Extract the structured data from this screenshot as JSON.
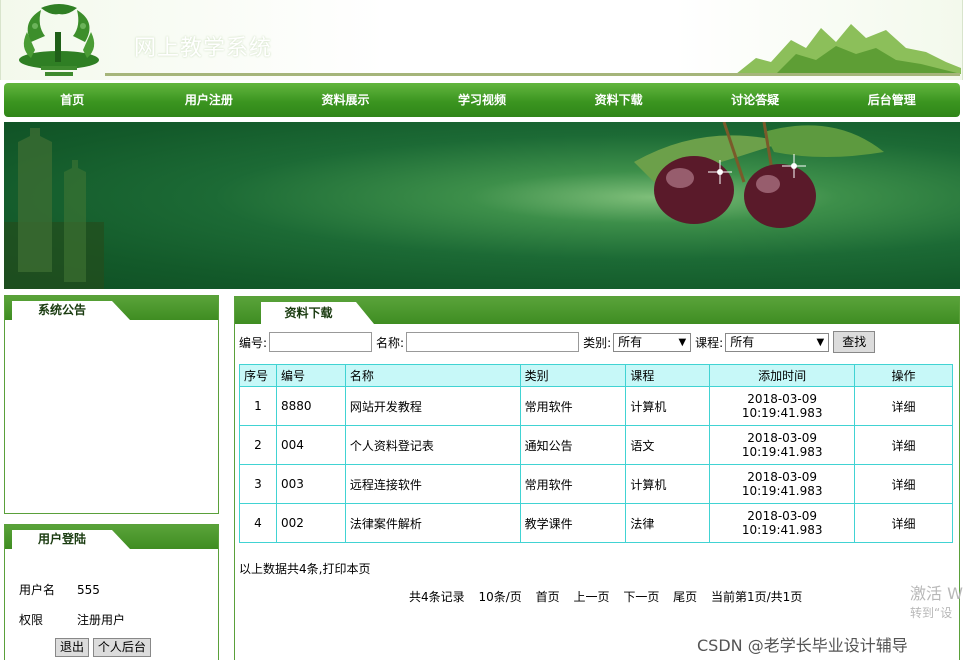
{
  "site": {
    "title": "网上教学系统"
  },
  "nav": {
    "items": [
      {
        "label": "首页"
      },
      {
        "label": "用户注册"
      },
      {
        "label": "资料展示"
      },
      {
        "label": "学习视频"
      },
      {
        "label": "资料下载"
      },
      {
        "label": "讨论答疑"
      },
      {
        "label": "后台管理"
      }
    ]
  },
  "notice": {
    "title": "系统公告"
  },
  "login": {
    "title": "用户登陆",
    "username_label": "用户名",
    "username_value": "555",
    "role_label": "权限",
    "role_value": "注册用户",
    "logout_label": "退出",
    "backend_label": "个人后台"
  },
  "main": {
    "title": "资料下载",
    "filter": {
      "code_label": "编号:",
      "code_value": "",
      "name_label": "名称:",
      "name_value": "",
      "type_label": "类别:",
      "type_value": "所有",
      "course_label": "课程:",
      "course_value": "所有",
      "search_label": "查找"
    },
    "table": {
      "headers": [
        "序号",
        "编号",
        "名称",
        "类别",
        "课程",
        "添加时间",
        "操作"
      ],
      "rows": [
        {
          "index": "1",
          "code": "8880",
          "name": "网站开发教程",
          "type": "常用软件",
          "course": "计算机",
          "date": "2018-03-09",
          "time": "10:19:41.983",
          "action": "详细"
        },
        {
          "index": "2",
          "code": "004",
          "name": "个人资料登记表",
          "type": "通知公告",
          "course": "语文",
          "date": "2018-03-09",
          "time": "10:19:41.983",
          "action": "详细"
        },
        {
          "index": "3",
          "code": "003",
          "name": "远程连接软件",
          "type": "常用软件",
          "course": "计算机",
          "date": "2018-03-09",
          "time": "10:19:41.983",
          "action": "详细"
        },
        {
          "index": "4",
          "code": "002",
          "name": "法律案件解析",
          "type": "教学课件",
          "course": "法律",
          "date": "2018-03-09",
          "time": "10:19:41.983",
          "action": "详细"
        }
      ]
    },
    "summary": "以上数据共4条,打印本页",
    "pager": {
      "total": "共4条记录",
      "per_page": "10条/页",
      "first": "首页",
      "prev": "上一页",
      "next": "下一页",
      "last": "尾页",
      "current": "当前第1页/共1页"
    }
  },
  "overlay": {
    "watermark": "CSDN @老学长毕业设计辅导",
    "activate": "激活 W",
    "activate_sub": "转到“设"
  },
  "colors": {
    "nav_green": "#3b9520",
    "table_border": "#41d3d3",
    "table_header": "#c7f8f8"
  }
}
